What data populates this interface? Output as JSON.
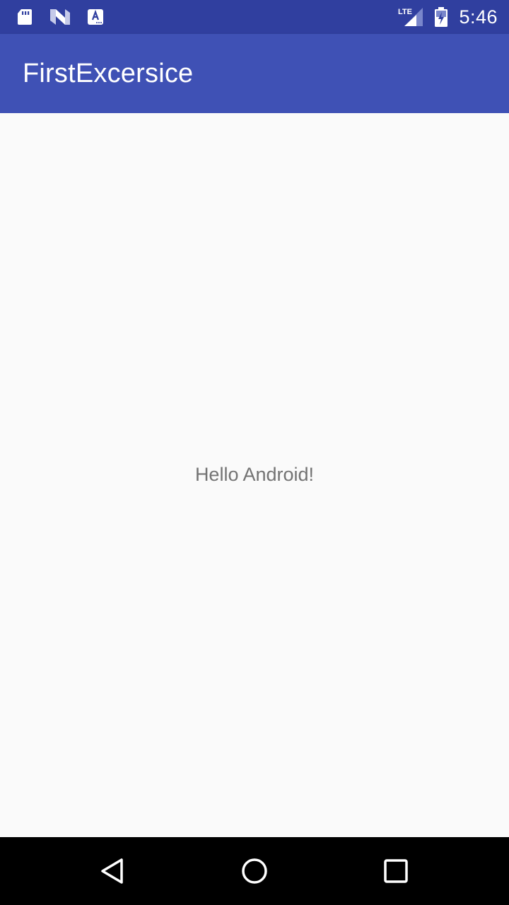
{
  "status_bar": {
    "time": "5:46",
    "network_label": "LTE",
    "icons": [
      "sd-card-icon",
      "n-notification-icon",
      "a-notification-icon",
      "lte-signal-icon",
      "battery-icon"
    ]
  },
  "app_bar": {
    "title": "FirstExcersice"
  },
  "content": {
    "message": "Hello Android!"
  },
  "nav_bar": {
    "icons": [
      "back-icon",
      "home-icon",
      "recents-icon"
    ]
  },
  "colors": {
    "status_bar": "#303f9f",
    "app_bar": "#3f51b5",
    "background": "#fafafa",
    "text": "#737373",
    "nav_bar": "#000000"
  }
}
